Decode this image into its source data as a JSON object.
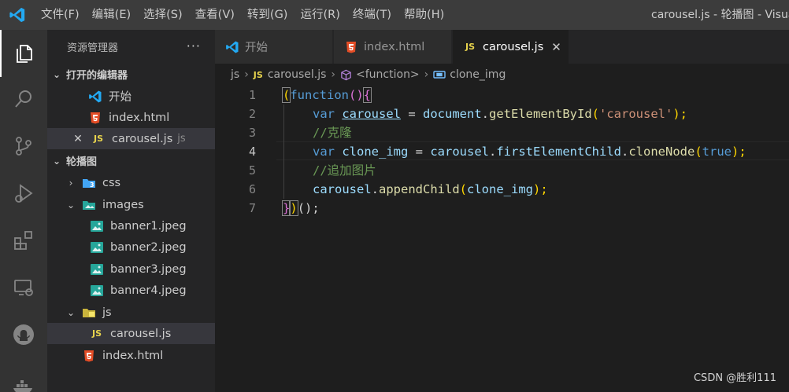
{
  "titlebar": {
    "menu": [
      "文件(F)",
      "编辑(E)",
      "选择(S)",
      "查看(V)",
      "转到(G)",
      "运行(R)",
      "终端(T)",
      "帮助(H)"
    ],
    "window_title": "carousel.js - 轮播图 - Visua"
  },
  "sidebar": {
    "title": "资源管理器",
    "more": "···",
    "open_editors": {
      "label": "打开的编辑器",
      "items": [
        {
          "name": "开始"
        },
        {
          "name": "index.html"
        },
        {
          "name": "carousel.js",
          "hint": "js"
        }
      ]
    },
    "workspace": {
      "label": "轮播图",
      "items": {
        "css": "css",
        "images": "images",
        "banner1": "banner1.jpeg",
        "banner2": "banner2.jpeg",
        "banner3": "banner3.jpeg",
        "banner4": "banner4.jpeg",
        "js": "js",
        "carousel": "carousel.js",
        "index": "index.html"
      }
    }
  },
  "tabs": [
    {
      "label": "开始"
    },
    {
      "label": "index.html"
    },
    {
      "label": "carousel.js",
      "close": "✕"
    }
  ],
  "breadcrumb": {
    "folder": "js",
    "file": "carousel.js",
    "scope": "<function>",
    "symbol": "clone_img",
    "js_badge": "JS"
  },
  "editor": {
    "line_numbers": [
      "1",
      "2",
      "3",
      "4",
      "5",
      "6",
      "7"
    ],
    "code": {
      "l1": {
        "open_paren": "(",
        "kw": "function",
        "parens": "()",
        "brace": "{"
      },
      "l2": {
        "kw": "var",
        "var": "carousel",
        "eq": " = ",
        "obj": "document",
        "dot": ".",
        "fn": "getElementById",
        "p1": "(",
        "str": "'carousel'",
        "p2": ");"
      },
      "l3": {
        "comment": "//克隆"
      },
      "l4": {
        "kw": "var",
        "var": "clone_img",
        "eq": " = ",
        "obj": "carousel",
        "dot1": ".",
        "prop": "firstElementChild",
        "dot2": ".",
        "fn": "cloneNode",
        "p1": "(",
        "arg": "true",
        "p2": ");"
      },
      "l5": {
        "comment": "//追加图片"
      },
      "l6": {
        "obj": "carousel",
        "dot": ".",
        "fn": "appendChild",
        "p1": "(",
        "arg": "clone_img",
        "p2": ");"
      },
      "l7": {
        "brace": "}",
        "paren": ")",
        "call": "();"
      }
    }
  },
  "watermark": "CSDN @胜利111",
  "colors": {
    "titlebar": "#3c3c3c",
    "activitybar": "#333333",
    "sidebar": "#252526",
    "editor": "#1e1e1e",
    "vscode_blue": "#23a9f2",
    "html_orange": "#e44d26",
    "js_yellow": "#e8d44d",
    "keyword": "#569cd6",
    "variable": "#9cdcfe",
    "function": "#dcdcaa",
    "string": "#ce9178",
    "comment": "#6a9955"
  }
}
